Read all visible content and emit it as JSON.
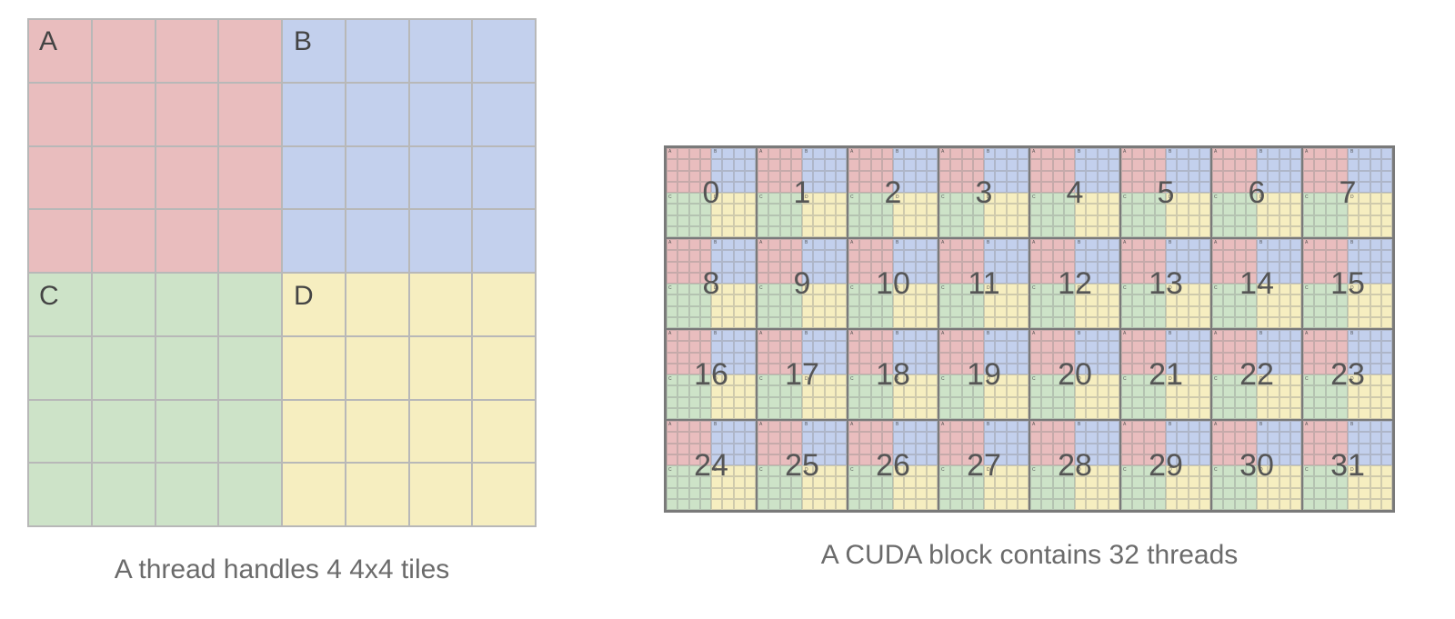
{
  "left": {
    "caption": "A thread handles 4 4x4 tiles",
    "labels": {
      "A": "A",
      "B": "B",
      "C": "C",
      "D": "D"
    }
  },
  "right": {
    "caption": "A CUDA block contains 32 threads",
    "thread_count": 32,
    "labels": {
      "A": "A",
      "B": "B",
      "C": "C",
      "D": "D"
    }
  },
  "colors": {
    "A": "#e9bdbe",
    "B": "#c3d0ed",
    "C": "#cde3c8",
    "D": "#f6eec0",
    "grid": "#b8b8b8"
  },
  "thread_grid": {
    "tiles_per_thread": 4,
    "tile_size": "4x4"
  },
  "block_grid": {
    "cols": 8,
    "rows": 4
  }
}
